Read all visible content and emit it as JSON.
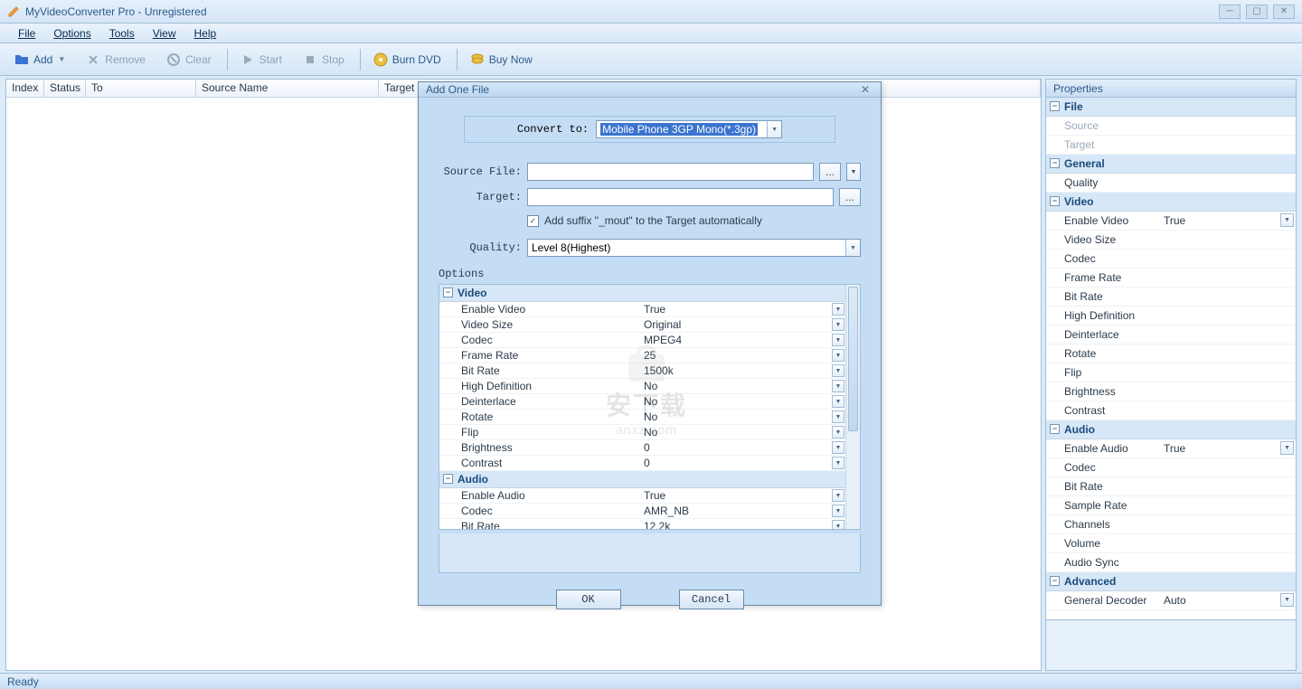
{
  "window": {
    "title": "MyVideoConverter Pro - Unregistered"
  },
  "menubar": {
    "items": [
      "File",
      "Options",
      "Tools",
      "View",
      "Help"
    ]
  },
  "toolbar": {
    "add": "Add",
    "remove": "Remove",
    "clear": "Clear",
    "start": "Start",
    "stop": "Stop",
    "burn_dvd": "Burn DVD",
    "buy_now": "Buy Now"
  },
  "list": {
    "headers": [
      "Index",
      "Status",
      "To",
      "Source Name",
      "Target Name"
    ]
  },
  "properties": {
    "title": "Properties",
    "sections": [
      {
        "name": "File",
        "rows": [
          {
            "k": "Source",
            "v": "",
            "disabled": true
          },
          {
            "k": "Target",
            "v": "",
            "disabled": true
          }
        ]
      },
      {
        "name": "General",
        "rows": [
          {
            "k": "Quality",
            "v": ""
          }
        ]
      },
      {
        "name": "Video",
        "rows": [
          {
            "k": "Enable Video",
            "v": "True",
            "dd": true
          },
          {
            "k": "Video Size",
            "v": ""
          },
          {
            "k": "Codec",
            "v": ""
          },
          {
            "k": "Frame Rate",
            "v": ""
          },
          {
            "k": "Bit Rate",
            "v": ""
          },
          {
            "k": "High Definition",
            "v": ""
          },
          {
            "k": "Deinterlace",
            "v": ""
          },
          {
            "k": "Rotate",
            "v": ""
          },
          {
            "k": "Flip",
            "v": ""
          },
          {
            "k": "Brightness",
            "v": ""
          },
          {
            "k": "Contrast",
            "v": ""
          }
        ]
      },
      {
        "name": "Audio",
        "rows": [
          {
            "k": "Enable Audio",
            "v": "True",
            "dd": true
          },
          {
            "k": "Codec",
            "v": ""
          },
          {
            "k": "Bit Rate",
            "v": ""
          },
          {
            "k": "Sample Rate",
            "v": ""
          },
          {
            "k": "Channels",
            "v": ""
          },
          {
            "k": "Volume",
            "v": ""
          },
          {
            "k": "Audio Sync",
            "v": ""
          }
        ]
      },
      {
        "name": "Advanced",
        "rows": [
          {
            "k": "General Decoder",
            "v": "Auto",
            "dd": true
          }
        ]
      }
    ]
  },
  "statusbar": {
    "text": "Ready"
  },
  "dialog": {
    "title": "Add One File",
    "convert_to_label": "Convert to:",
    "convert_to_value": "Mobile Phone 3GP Mono(*.3gp)",
    "source_file_label": "Source File:",
    "source_file_value": "",
    "target_label": "Target:",
    "target_value": "",
    "suffix_checkbox": "Add suffix \"_mout\" to the Target automatically",
    "suffix_checked": true,
    "quality_label": "Quality:",
    "quality_value": "Level 8(Highest)",
    "options_label": "Options",
    "ok": "OK",
    "cancel": "Cancel",
    "opt_sections": [
      {
        "name": "Video",
        "rows": [
          {
            "k": "Enable Video",
            "v": "True"
          },
          {
            "k": "Video Size",
            "v": "Original"
          },
          {
            "k": "Codec",
            "v": "MPEG4"
          },
          {
            "k": "Frame Rate",
            "v": "25"
          },
          {
            "k": "Bit Rate",
            "v": "1500k"
          },
          {
            "k": "High Definition",
            "v": "No"
          },
          {
            "k": "Deinterlace",
            "v": "No"
          },
          {
            "k": "Rotate",
            "v": "No"
          },
          {
            "k": "Flip",
            "v": "No"
          },
          {
            "k": "Brightness",
            "v": "0"
          },
          {
            "k": "Contrast",
            "v": "0"
          }
        ]
      },
      {
        "name": "Audio",
        "rows": [
          {
            "k": "Enable Audio",
            "v": "True"
          },
          {
            "k": "Codec",
            "v": "AMR_NB"
          },
          {
            "k": "Bit Rate",
            "v": "12.2k"
          }
        ]
      }
    ]
  }
}
